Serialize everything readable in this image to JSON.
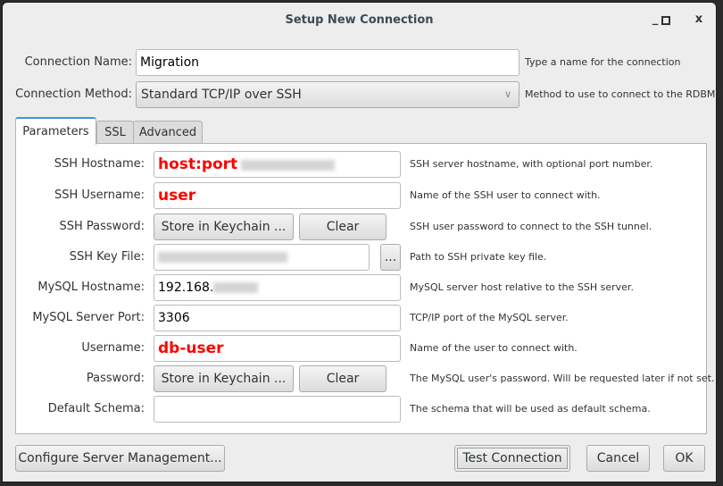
{
  "window": {
    "title": "Setup New Connection",
    "minimize": "_",
    "maximize": "□",
    "close": "x"
  },
  "connection_name": {
    "label": "Connection Name:",
    "value": "Migration",
    "hint": "Type a name for the connection"
  },
  "connection_method": {
    "label": "Connection Method:",
    "value": "Standard TCP/IP over SSH",
    "hint": "Method to use to connect to the RDBMS",
    "arrow": "chevron-down-icon"
  },
  "tabs": [
    {
      "label": "Parameters",
      "active": true
    },
    {
      "label": "SSL"
    },
    {
      "label": "Advanced"
    }
  ],
  "params": {
    "ssh_hostname": {
      "label": "SSH Hostname:",
      "value": "host:port",
      "hint": "SSH server hostname, with optional port number."
    },
    "ssh_username": {
      "label": "SSH Username:",
      "value": "user",
      "hint": "Name of the SSH user to connect with."
    },
    "ssh_password": {
      "label": "SSH Password:",
      "store": "Store in Keychain ...",
      "clear": "Clear",
      "hint": "SSH user password to connect to the SSH tunnel."
    },
    "ssh_key_file": {
      "label": "SSH Key File:",
      "browse": "...",
      "hint": "Path to SSH private key file."
    },
    "mysql_hostname": {
      "label": "MySQL Hostname:",
      "value": "192.168.",
      "hint": "MySQL server host relative to the SSH server."
    },
    "mysql_port": {
      "label": "MySQL Server Port:",
      "value": "3306",
      "hint": "TCP/IP port of the MySQL server."
    },
    "username": {
      "label": "Username:",
      "value": "db-user",
      "hint": "Name of the user to connect with."
    },
    "password": {
      "label": "Password:",
      "store": "Store in Keychain ...",
      "clear": "Clear",
      "hint": "The MySQL user's password. Will be requested later if not set."
    },
    "default_schema": {
      "label": "Default Schema:",
      "value": "",
      "hint": "The schema that will be used as default schema."
    }
  },
  "footer": {
    "configure": "Configure Server Management...",
    "test": "Test Connection",
    "cancel": "Cancel",
    "ok": "OK"
  },
  "colors": {
    "highlight_text": "#ff0000",
    "tab_accent": "#4a90d9"
  }
}
